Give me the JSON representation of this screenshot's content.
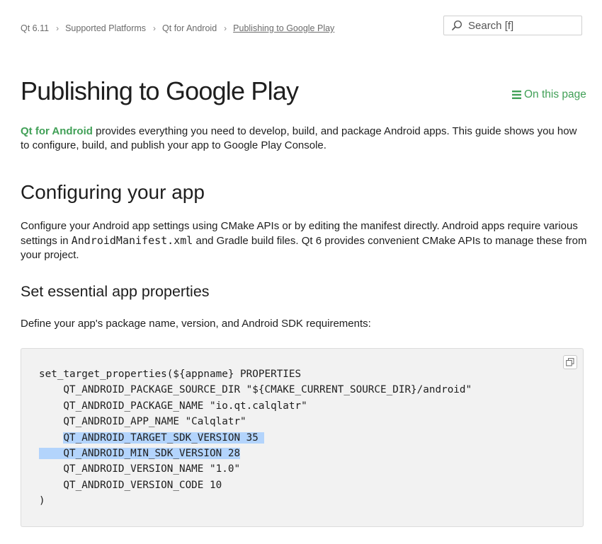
{
  "breadcrumb": {
    "items": [
      "Qt 6.11",
      "Supported Platforms",
      "Qt for Android"
    ],
    "current": "Publishing to Google Play"
  },
  "search": {
    "placeholder": "Search [f]",
    "icon": "search-icon"
  },
  "page": {
    "title": "Publishing to Google Play",
    "on_this_page": "On this page"
  },
  "intro": {
    "link": "Qt for Android",
    "text": " provides everything you need to develop, build, and package Android apps. This guide shows you how to configure, build, and publish your app to Google Play Console."
  },
  "section": {
    "heading": "Configuring your app",
    "para_before": "Configure your Android app settings using CMake APIs or by editing the manifest directly. Android apps require various settings in ",
    "para_code": "AndroidManifest.xml",
    "para_after": " and Gradle build files. Qt 6 provides convenient CMake APIs to manage these from your project."
  },
  "subsection": {
    "heading": "Set essential app properties",
    "para": "Define your app's package name, version, and Android SDK requirements:"
  },
  "code": {
    "copy_icon": "copy-icon",
    "lines": [
      "set_target_properties(${appname} PROPERTIES",
      "    QT_ANDROID_PACKAGE_SOURCE_DIR \"${CMAKE_CURRENT_SOURCE_DIR}/android\"",
      "    QT_ANDROID_PACKAGE_NAME \"io.qt.calqlatr\"",
      "    QT_ANDROID_APP_NAME \"Calqlatr\"",
      "    QT_ANDROID_TARGET_SDK_VERSION 35",
      "    QT_ANDROID_MIN_SDK_VERSION 28",
      "    QT_ANDROID_VERSION_NAME \"1.0\"",
      "    QT_ANDROID_VERSION_CODE 10",
      ")"
    ]
  },
  "colors": {
    "accent": "#41a057",
    "selection": "#b3d4fc",
    "code_bg": "#f2f2f2"
  }
}
